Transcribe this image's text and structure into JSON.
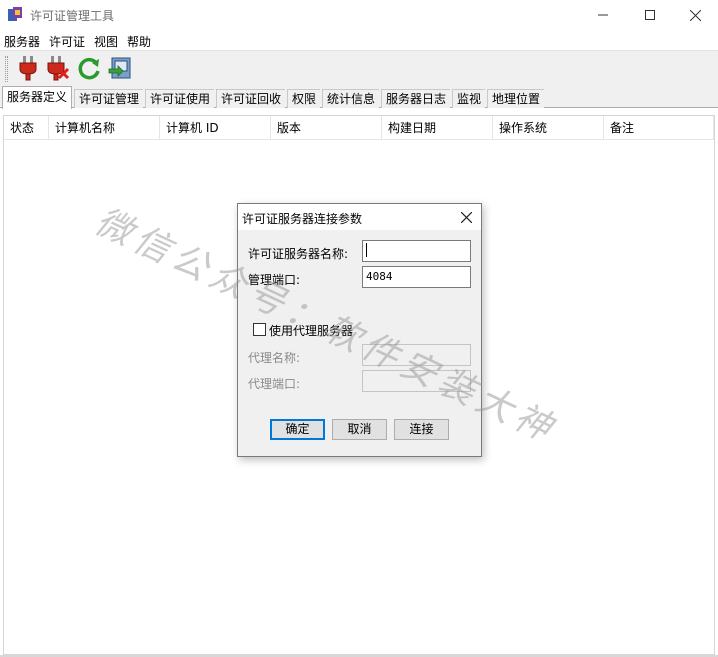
{
  "window": {
    "title": "许可证管理工具",
    "icons": [
      "app-icon",
      "minimize-icon",
      "maximize-icon",
      "close-icon"
    ]
  },
  "menu": {
    "items": [
      "服务器",
      "许可证",
      "视图",
      "帮助"
    ]
  },
  "toolbar": {
    "buttons": [
      {
        "name": "connect-plug-icon"
      },
      {
        "name": "disconnect-plug-icon"
      },
      {
        "name": "refresh-icon"
      },
      {
        "name": "server-settings-icon"
      }
    ]
  },
  "tabs": [
    {
      "label": "服务器定义",
      "active": true
    },
    {
      "label": "许可证管理",
      "active": false
    },
    {
      "label": "许可证使用",
      "active": false
    },
    {
      "label": "许可证回收",
      "active": false
    },
    {
      "label": "权限",
      "active": false
    },
    {
      "label": "统计信息",
      "active": false
    },
    {
      "label": "服务器日志",
      "active": false
    },
    {
      "label": "监视",
      "active": false
    },
    {
      "label": "地理位置",
      "active": false
    }
  ],
  "table": {
    "columns": [
      "状态",
      "计算机名称",
      "计算机 ID",
      "版本",
      "构建日期",
      "操作系统",
      "备注"
    ]
  },
  "watermark": "微信公众号：软件安装大神",
  "dialog": {
    "title": "许可证服务器连接参数",
    "server_name_label": "许可证服务器名称:",
    "server_name_value": "",
    "port_label": "管理端口:",
    "port_value": "4084",
    "use_proxy_label": "使用代理服务器",
    "use_proxy_checked": false,
    "proxy_name_label": "代理名称:",
    "proxy_port_label": "代理端口:",
    "ok_label": "确定",
    "cancel_label": "取消",
    "connect_label": "连接"
  },
  "colors": {
    "accent": "#0078d7",
    "toolbar_bg": "#f0f0f0",
    "plug_red": "#cc2a1d",
    "refresh_green": "#2a9a2e"
  }
}
